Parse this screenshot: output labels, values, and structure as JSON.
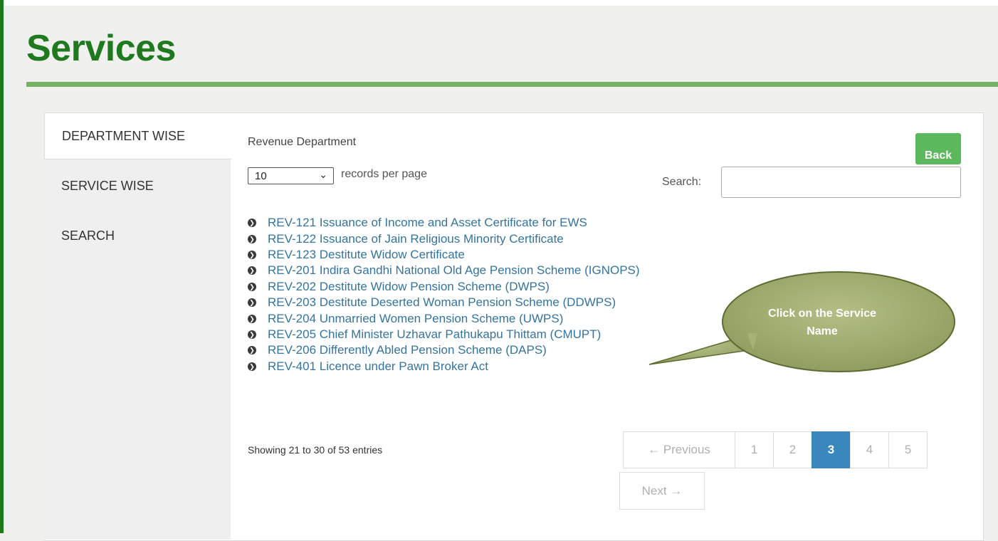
{
  "page": {
    "title": "Services"
  },
  "nav": {
    "items": [
      {
        "label": "DEPARTMENT WISE",
        "active": true
      },
      {
        "label": "SERVICE WISE",
        "active": false
      },
      {
        "label": "SEARCH",
        "active": false
      }
    ]
  },
  "main": {
    "department": "Revenue Department",
    "back_label": "Back",
    "length": {
      "value": "10",
      "suffix": "records per page"
    },
    "search": {
      "label": "Search:",
      "value": ""
    },
    "services": [
      "REV-121 Issuance of Income and Asset Certificate for EWS",
      "REV-122 Issuance of Jain Religious Minority Certificate",
      "REV-123 Destitute Widow Certificate",
      "REV-201 Indira Gandhi National Old Age Pension Scheme (IGNOPS)",
      "REV-202 Destitute Widow Pension Scheme (DWPS)",
      "REV-203 Destitute Deserted Woman Pension Scheme (DDWPS)",
      "REV-204 Unmarried Women Pension Scheme (UWPS)",
      "REV-205 Chief Minister Uzhavar Pathukapu Thittam (CMUPT)",
      "REV-206 Differently Abled Pension Scheme (DAPS)",
      "REV-401 Licence under Pawn Broker Act"
    ],
    "info": "Showing 21 to 30 of 53 entries",
    "pagination": {
      "previous": "← Previous",
      "pages": [
        "1",
        "2",
        "3",
        "4",
        "5"
      ],
      "current": "3",
      "next": "Next →"
    }
  },
  "callout": {
    "line1": "Click on the Service",
    "line2": "Name"
  },
  "colors": {
    "title_green": "#1f7a1f",
    "rule_green": "#76b264",
    "back_green": "#5cb85c",
    "link_blue": "#34749f",
    "active_page_blue": "#3a87be",
    "callout_olive": "#9eaa6e"
  }
}
